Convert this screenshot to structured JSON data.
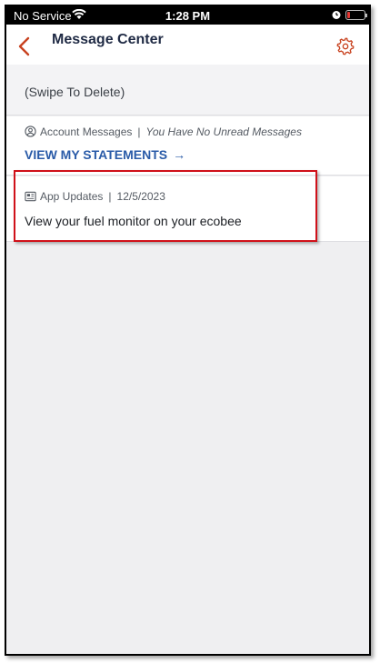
{
  "status_bar": {
    "carrier": "No Service",
    "time": "1:28 PM"
  },
  "nav": {
    "title": "Message Center"
  },
  "swipe_hint": "(Swipe To Delete)",
  "account_messages": {
    "category": "Account Messages",
    "status": "You Have No Unread Messages",
    "link_label": "VIEW MY STATEMENTS",
    "link_arrow": "→"
  },
  "app_update": {
    "category": "App Updates",
    "date": "12/5/2023",
    "message": "View your fuel monitor on your ecobee"
  },
  "colors": {
    "accent": "#c8421f",
    "link": "#2a5ba8",
    "highlight": "#d0111a"
  }
}
